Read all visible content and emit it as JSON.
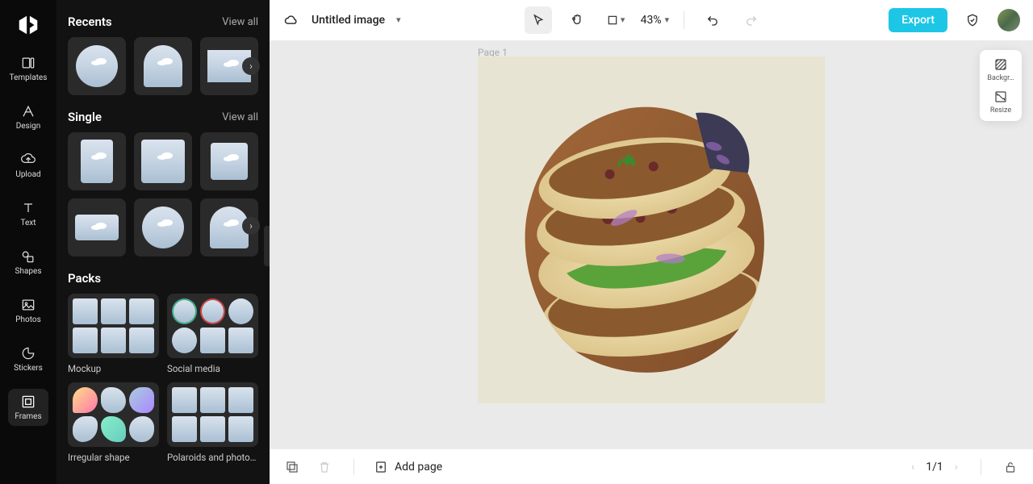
{
  "app": {
    "title": "Untitled image"
  },
  "nav": {
    "items": [
      {
        "id": "templates",
        "label": "Templates"
      },
      {
        "id": "design",
        "label": "Design"
      },
      {
        "id": "upload",
        "label": "Upload"
      },
      {
        "id": "text",
        "label": "Text"
      },
      {
        "id": "shapes",
        "label": "Shapes"
      },
      {
        "id": "photos",
        "label": "Photos"
      },
      {
        "id": "stickers",
        "label": "Stickers"
      },
      {
        "id": "frames",
        "label": "Frames"
      }
    ],
    "active": "frames"
  },
  "panel": {
    "sections": {
      "recents": {
        "title": "Recents",
        "view_all": "View all"
      },
      "single": {
        "title": "Single",
        "view_all": "View all"
      },
      "packs": {
        "title": "Packs",
        "items": [
          {
            "label": "Mockup"
          },
          {
            "label": "Social media"
          },
          {
            "label": "Irregular shape"
          },
          {
            "label": "Polaroids and photo f…"
          }
        ]
      }
    }
  },
  "topbar": {
    "zoom": "43%",
    "export": "Export"
  },
  "canvas": {
    "page_label": "Page 1"
  },
  "right_panel": {
    "background": "Backgr…",
    "resize": "Resize"
  },
  "bottombar": {
    "add_page": "Add page",
    "pager": "1/1"
  }
}
